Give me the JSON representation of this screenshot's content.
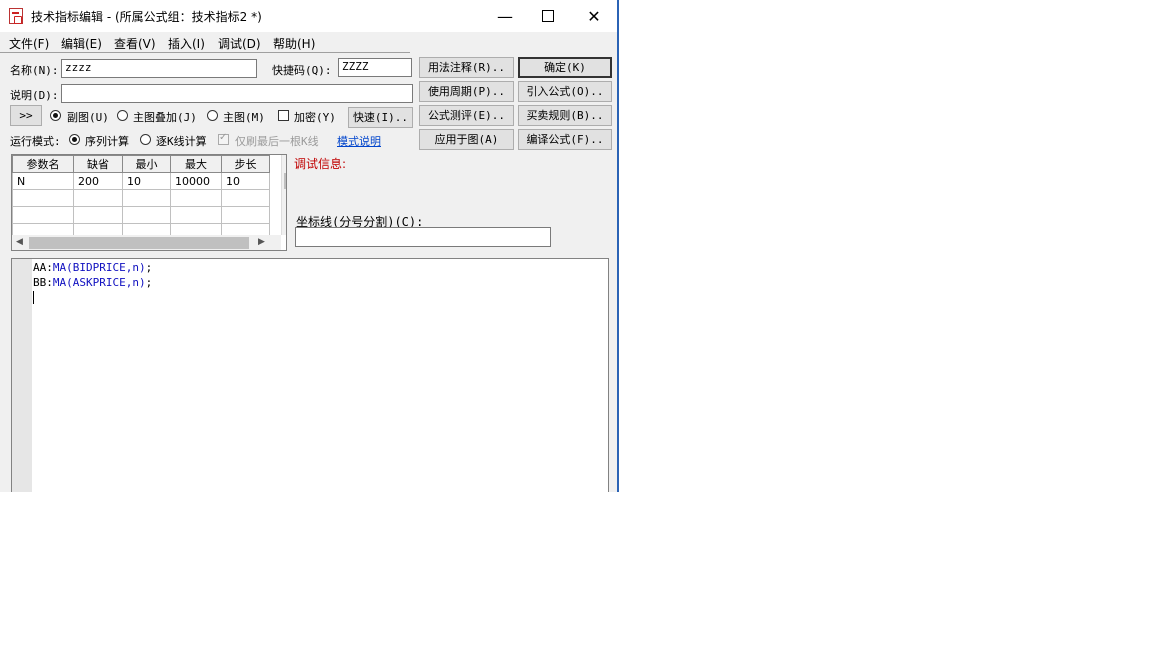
{
  "window": {
    "title": "技术指标编辑 - (所属公式组：技术指标2 *)",
    "minimize_symbol": "—",
    "close_symbol": "✕"
  },
  "menu": [
    "文件(F)",
    "编辑(E)",
    "查看(V)",
    "插入(I)",
    "调试(D)",
    "帮助(H)"
  ],
  "form": {
    "name_label": "名称(N):",
    "name_value": "zzzz",
    "shortcut_label": "快捷码(Q):",
    "shortcut_value": "ZZZZ",
    "desc_label": "说明(D):",
    "desc_value": "",
    "expand_label": ">>",
    "radio_subchart": "副图(U)",
    "radio_overlay": "主图叠加(J)",
    "radio_main": "主图(M)",
    "check_encrypt": "加密(Y)",
    "quick_label": "快速(I)..",
    "run_mode_label": "运行模式:",
    "radio_sequence": "序列计算",
    "radio_bykline": "逐K线计算",
    "check_lastonly": "仅刷最后一根K线",
    "mode_link": "模式说明"
  },
  "buttons": {
    "usage_note": "用法注释(R)..",
    "ok": "确定(K)",
    "period": "使用周期(P)..",
    "import": "引入公式(O)..",
    "test": "公式测评(E)..",
    "trade_rule": "买卖规则(B)..",
    "apply": "应用于图(A)",
    "compile": "编译公式(F).."
  },
  "params": {
    "headers": [
      "参数名",
      "缺省",
      "最小",
      "最大",
      "步长"
    ],
    "rows": [
      [
        "N",
        "200",
        "10",
        "10000",
        "10"
      ]
    ]
  },
  "debug_label": "调试信息:",
  "axis_label": "坐标线(分号分割)(C):",
  "axis_value": "",
  "code": {
    "line1_var": "AA:",
    "line1_fn": "MA(BIDPRICE,n)",
    "line1_end": ";",
    "line2_var": "BB:",
    "line2_fn": "MA(ASKPRICE,n)",
    "line2_end": ";"
  }
}
